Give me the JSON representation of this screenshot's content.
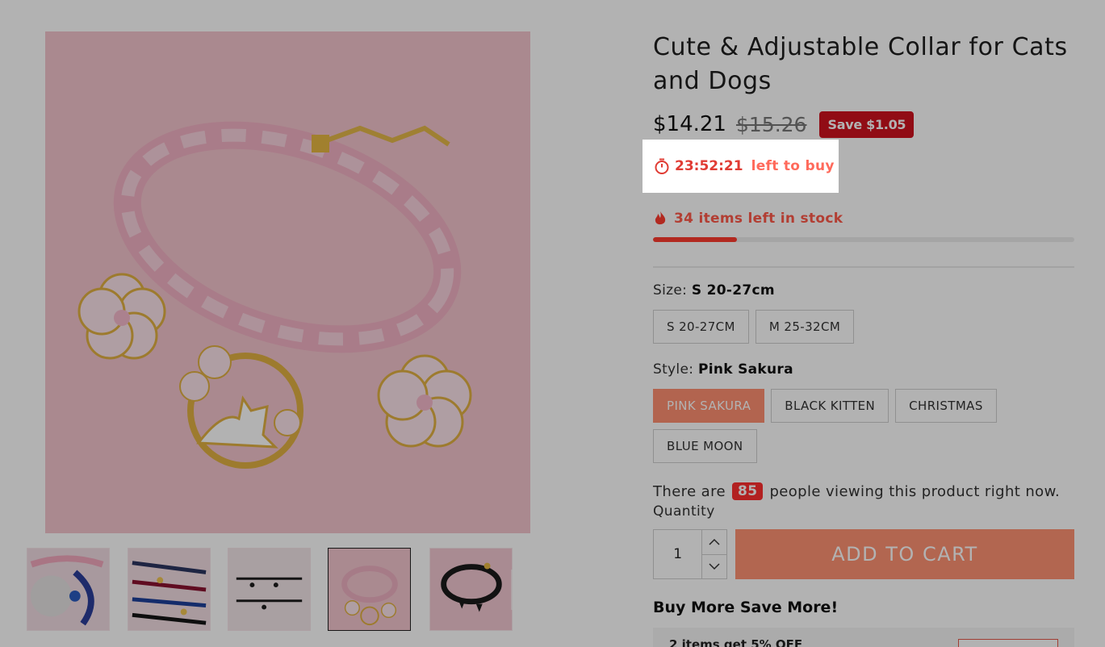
{
  "product": {
    "title": "Cute & Adjustable Collar for Cats and Dogs",
    "price": "$14.21",
    "compare_price": "$15.26",
    "save_badge": "Save $1.05"
  },
  "timer": {
    "time": "23:52:21",
    "label": "left to buy",
    "icon": "stopwatch-icon"
  },
  "stock": {
    "text": "34 items left in stock",
    "icon": "flame-icon",
    "fill_fraction": 0.2
  },
  "size": {
    "label": "Size:",
    "selected": "S 20-27cm",
    "options": [
      "S 20-27CM",
      "M 25-32CM"
    ]
  },
  "style": {
    "label": "Style:",
    "selected": "Pink Sakura",
    "options": [
      "PINK SAKURA",
      "BLACK KITTEN",
      "CHRISTMAS",
      "BLUE MOON"
    ],
    "selected_index": 0
  },
  "viewers": {
    "prefix": "There are",
    "count": "85",
    "suffix": "people viewing this product right now."
  },
  "quantity": {
    "label": "Quantity",
    "value": "1",
    "increment_icon": "chevron-up-icon",
    "decrement_icon": "chevron-down-icon"
  },
  "cart": {
    "add_label": "ADD TO CART"
  },
  "bundle": {
    "title": "Buy More Save More!",
    "tier_1": "2 items get 5% OFF"
  },
  "gallery": {
    "prev_icon": "chevron-left-icon",
    "next_icon": "chevron-right-icon",
    "active_thumb_index": 3,
    "thumb_count": 5
  },
  "colors": {
    "accent": "#ff9373",
    "sale_red": "#d0121f",
    "timer_red": "#e03c34",
    "stock_bar": "#ff3b2f"
  }
}
